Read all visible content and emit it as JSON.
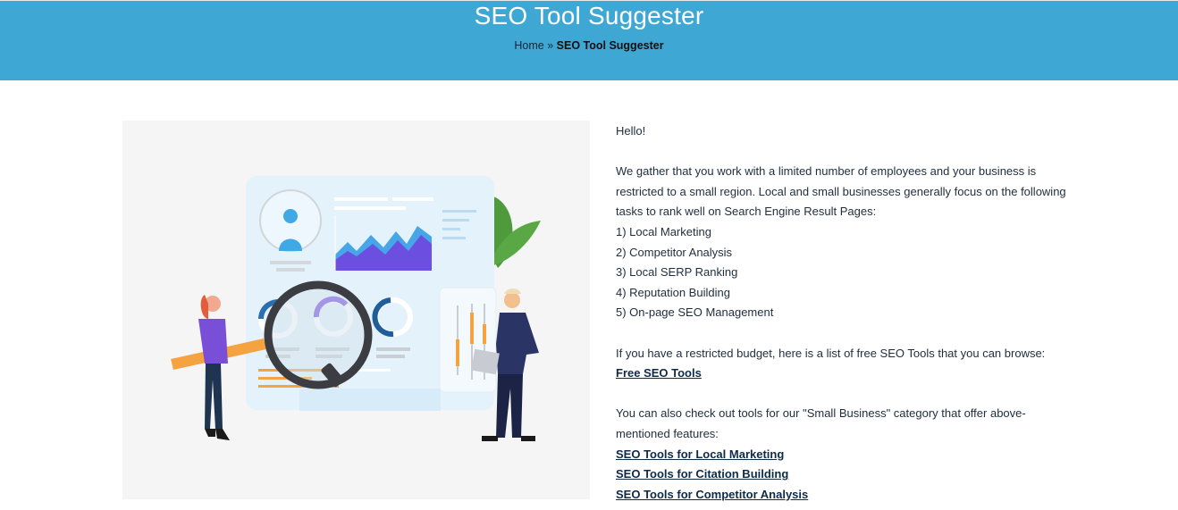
{
  "header": {
    "title": "SEO Tool Suggester",
    "breadcrumb": {
      "home": "Home",
      "separator": " » ",
      "current": "SEO Tool Suggester"
    }
  },
  "illustration": {
    "icon": "seo-analysis-illustration",
    "colors": {
      "background": "#f5f5f5",
      "panel": "#e4f2fb",
      "chart_fill": "#6c4fe0",
      "chart_accent": "#46a6e8",
      "leaf": "#4f9a3a",
      "woman_shirt": "#7a4fd8",
      "man_suit": "#2a3565",
      "pencil": "#f5a340"
    }
  },
  "content": {
    "greeting": "Hello!",
    "intro_lines": [
      "We gather that you work with a limited number of employees and your business is",
      "restricted to a small region. Local and small businesses generally focus on the following",
      "tasks to rank well on Search Engine Result Pages:"
    ],
    "tasks": [
      "1) Local Marketing",
      "2) Competitor Analysis",
      "3) Local SERP Ranking",
      "4) Reputation Building",
      "5) On-page SEO Management"
    ],
    "budget_text": "If you have a restricted budget, here is a list of free SEO Tools that you can browse:",
    "free_tools_link": "Free SEO Tools",
    "category_lines": [
      "You can also check out tools for our \"Small Business\" category  that offer above-",
      "mentioned features:"
    ],
    "category_links": [
      "SEO Tools for Local Marketing",
      "SEO Tools for Citation Building",
      "SEO Tools for Competitor Analysis"
    ]
  }
}
